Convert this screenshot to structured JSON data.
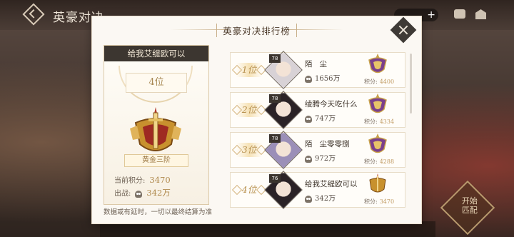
{
  "top": {
    "title": "英豪对决",
    "currency_plus": "+"
  },
  "panel": {
    "title": "英豪对决排行榜"
  },
  "me": {
    "name": "给我艾缇欧可以",
    "rank": "4位",
    "tier": "黄金三阶",
    "score_label": "当前积分:",
    "score": "3470",
    "power_label": "出战:",
    "power": "342万"
  },
  "note": "数据或有延时，一切以最终结算为准",
  "ranking": [
    {
      "rank": "1位",
      "level": "78",
      "name": "陌   尘",
      "power": "1656万",
      "score_label": "积分:",
      "score": "4400",
      "top": true,
      "avatar_color": "#d8d2d6"
    },
    {
      "rank": "2位",
      "level": "78",
      "name": "绫腾今天吃什么",
      "power": "747万",
      "score_label": "积分:",
      "score": "4334",
      "top": true,
      "avatar_color": "#2a2226"
    },
    {
      "rank": "3位",
      "level": "78",
      "name": "陌   尘零零捌",
      "power": "972万",
      "score_label": "积分:",
      "score": "4288",
      "top": true,
      "avatar_color": "#9b8fb8"
    },
    {
      "rank": "4位",
      "level": "76",
      "name": "给我艾缇欧可以",
      "power": "342万",
      "score_label": "积分:",
      "score": "3470",
      "top": false,
      "avatar_color": "#2a2226"
    }
  ],
  "start": "开始\n匹配"
}
